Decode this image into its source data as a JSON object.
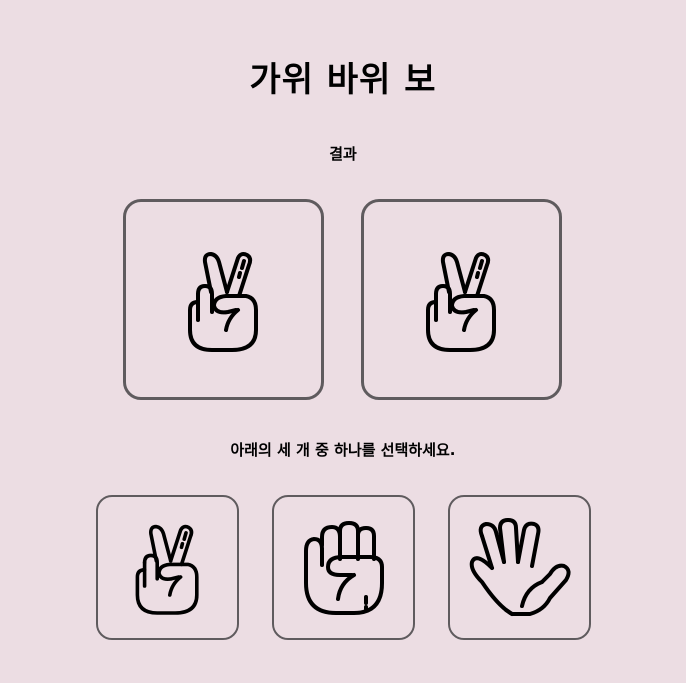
{
  "title": "가위 바위 보",
  "result_label": "결과",
  "result": {
    "user_choice_icon": "scissors-hand-icon",
    "computer_choice_icon": "scissors-hand-icon"
  },
  "prompt": "아래의 세 개 중 하나를 선택하세요.",
  "choices": [
    {
      "id": "scissors",
      "icon": "scissors-hand-icon"
    },
    {
      "id": "rock",
      "icon": "rock-fist-icon"
    },
    {
      "id": "paper",
      "icon": "paper-open-hand-icon"
    }
  ],
  "colors": {
    "background": "#ecdde3",
    "border": "#5f5b5e",
    "icon_stroke": "#000000"
  }
}
